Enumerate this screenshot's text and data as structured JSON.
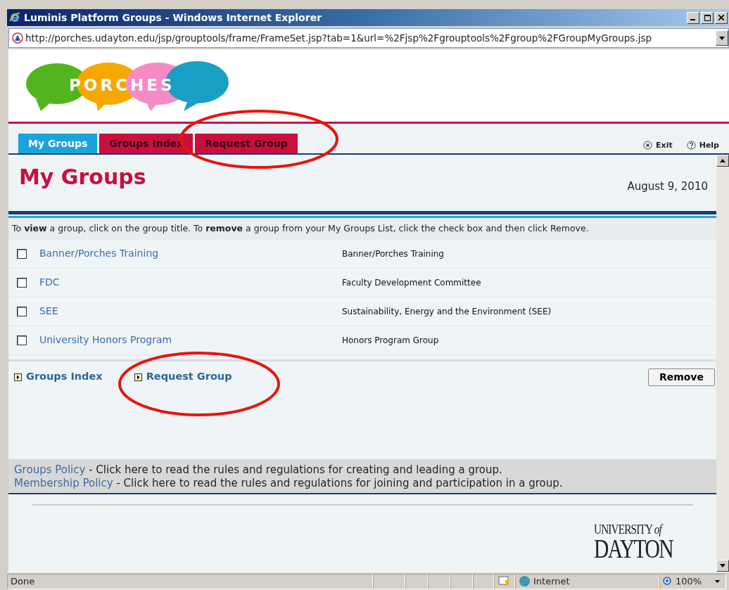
{
  "window": {
    "title": "Luminis Platform Groups - Windows Internet Explorer",
    "address": "http://porches.udayton.edu/jsp/grouptools/frame/FrameSet.jsp?tab=1&url=%2Fjsp%2Fgrouptools%2Fgroup%2FGroupMyGroups.jsp"
  },
  "logo": {
    "text": "P O R C H E S"
  },
  "tabs": [
    {
      "label": "My Groups",
      "selected": true
    },
    {
      "label": "Groups Index",
      "selected": false
    },
    {
      "label": "Request Group",
      "selected": false
    }
  ],
  "header_links": [
    {
      "label": "Exit",
      "kind": "exit"
    },
    {
      "label": "Help",
      "kind": "help"
    }
  ],
  "page": {
    "title": "My Groups",
    "date": "August 9, 2010",
    "instructions": "To **view** a group, click on the group title. To **remove** a group from your My Groups List, click the check box and then click Remove."
  },
  "groups": [
    {
      "name": "Banner/Porches Training",
      "description": "Banner/Porches Training",
      "checked": false
    },
    {
      "name": "FDC",
      "description": "Faculty Development Committee",
      "checked": false
    },
    {
      "name": "SEE",
      "description": "Sustainability, Energy and the Environment (SEE)",
      "checked": false
    },
    {
      "name": "University Honors Program",
      "description": "Honors Program Group",
      "checked": false
    }
  ],
  "bottom_links": [
    "Groups Index",
    "Request Group"
  ],
  "remove_button": "Remove",
  "policies": [
    {
      "link": "Groups Policy",
      "text": "- Click here to read the rules and regulations for creating and leading a group."
    },
    {
      "link": "Membership Policy",
      "text": "- Click here to read the rules and regulations for joining and participation in a group."
    }
  ],
  "footer_logo": {
    "line1": "UNIVERSITY",
    "of": "of",
    "line2": "DAYTON"
  },
  "status_bar": {
    "text": "Done",
    "zone": "Internet",
    "zoom": "100%"
  },
  "annotations": [
    {
      "kind": "ellipse"
    },
    {
      "kind": "ellipse"
    }
  ]
}
